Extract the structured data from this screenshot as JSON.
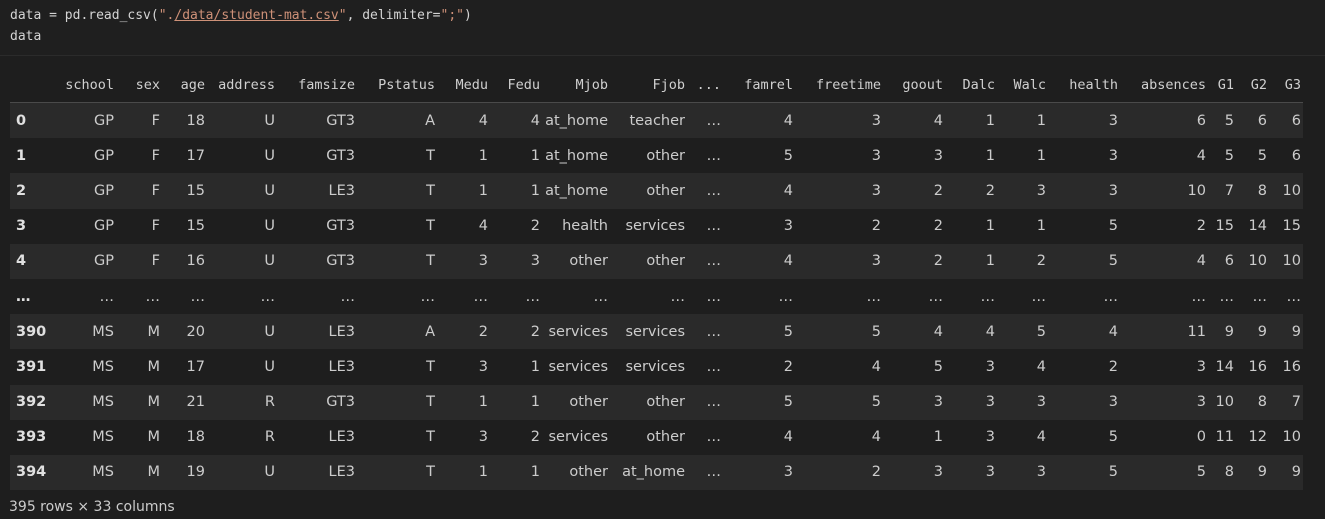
{
  "code": {
    "line1_prefix": "data = pd.read_csv(",
    "line1_quote_open": "\".",
    "line1_path": "/data/student-mat.csv",
    "line1_quote_close": "\"",
    "line1_mid": ", delimiter=",
    "line1_delim": "\";\"",
    "line1_suffix": ")",
    "line2": "data"
  },
  "table": {
    "columns": [
      "school",
      "sex",
      "age",
      "address",
      "famsize",
      "Pstatus",
      "Medu",
      "Fedu",
      "Mjob",
      "Fjob",
      "...",
      "famrel",
      "freetime",
      "goout",
      "Dalc",
      "Walc",
      "health",
      "absences",
      "G1",
      "G2",
      "G3"
    ],
    "rows": [
      {
        "index": "0",
        "cells": [
          "GP",
          "F",
          "18",
          "U",
          "GT3",
          "A",
          "4",
          "4",
          "at_home",
          "teacher",
          "…",
          "4",
          "3",
          "4",
          "1",
          "1",
          "3",
          "6",
          "5",
          "6",
          "6"
        ]
      },
      {
        "index": "1",
        "cells": [
          "GP",
          "F",
          "17",
          "U",
          "GT3",
          "T",
          "1",
          "1",
          "at_home",
          "other",
          "…",
          "5",
          "3",
          "3",
          "1",
          "1",
          "3",
          "4",
          "5",
          "5",
          "6"
        ]
      },
      {
        "index": "2",
        "cells": [
          "GP",
          "F",
          "15",
          "U",
          "LE3",
          "T",
          "1",
          "1",
          "at_home",
          "other",
          "…",
          "4",
          "3",
          "2",
          "2",
          "3",
          "3",
          "10",
          "7",
          "8",
          "10"
        ]
      },
      {
        "index": "3",
        "cells": [
          "GP",
          "F",
          "15",
          "U",
          "GT3",
          "T",
          "4",
          "2",
          "health",
          "services",
          "…",
          "3",
          "2",
          "2",
          "1",
          "1",
          "5",
          "2",
          "15",
          "14",
          "15"
        ]
      },
      {
        "index": "4",
        "cells": [
          "GP",
          "F",
          "16",
          "U",
          "GT3",
          "T",
          "3",
          "3",
          "other",
          "other",
          "…",
          "4",
          "3",
          "2",
          "1",
          "2",
          "5",
          "4",
          "6",
          "10",
          "10"
        ]
      },
      {
        "index": "…",
        "cells": [
          "…",
          "…",
          "…",
          "…",
          "…",
          "…",
          "…",
          "…",
          "…",
          "…",
          "…",
          "…",
          "…",
          "…",
          "…",
          "…",
          "…",
          "…",
          "…",
          "…",
          "…"
        ]
      },
      {
        "index": "390",
        "cells": [
          "MS",
          "M",
          "20",
          "U",
          "LE3",
          "A",
          "2",
          "2",
          "services",
          "services",
          "…",
          "5",
          "5",
          "4",
          "4",
          "5",
          "4",
          "11",
          "9",
          "9",
          "9"
        ]
      },
      {
        "index": "391",
        "cells": [
          "MS",
          "M",
          "17",
          "U",
          "LE3",
          "T",
          "3",
          "1",
          "services",
          "services",
          "…",
          "2",
          "4",
          "5",
          "3",
          "4",
          "2",
          "3",
          "14",
          "16",
          "16"
        ]
      },
      {
        "index": "392",
        "cells": [
          "MS",
          "M",
          "21",
          "R",
          "GT3",
          "T",
          "1",
          "1",
          "other",
          "other",
          "…",
          "5",
          "5",
          "3",
          "3",
          "3",
          "3",
          "3",
          "10",
          "8",
          "7"
        ]
      },
      {
        "index": "393",
        "cells": [
          "MS",
          "M",
          "18",
          "R",
          "LE3",
          "T",
          "3",
          "2",
          "services",
          "other",
          "…",
          "4",
          "4",
          "1",
          "3",
          "4",
          "5",
          "0",
          "11",
          "12",
          "10"
        ]
      },
      {
        "index": "394",
        "cells": [
          "MS",
          "M",
          "19",
          "U",
          "LE3",
          "T",
          "1",
          "1",
          "other",
          "at_home",
          "…",
          "3",
          "2",
          "3",
          "3",
          "3",
          "5",
          "5",
          "8",
          "9",
          "9"
        ]
      }
    ]
  },
  "footer": "395 rows × 33 columns"
}
